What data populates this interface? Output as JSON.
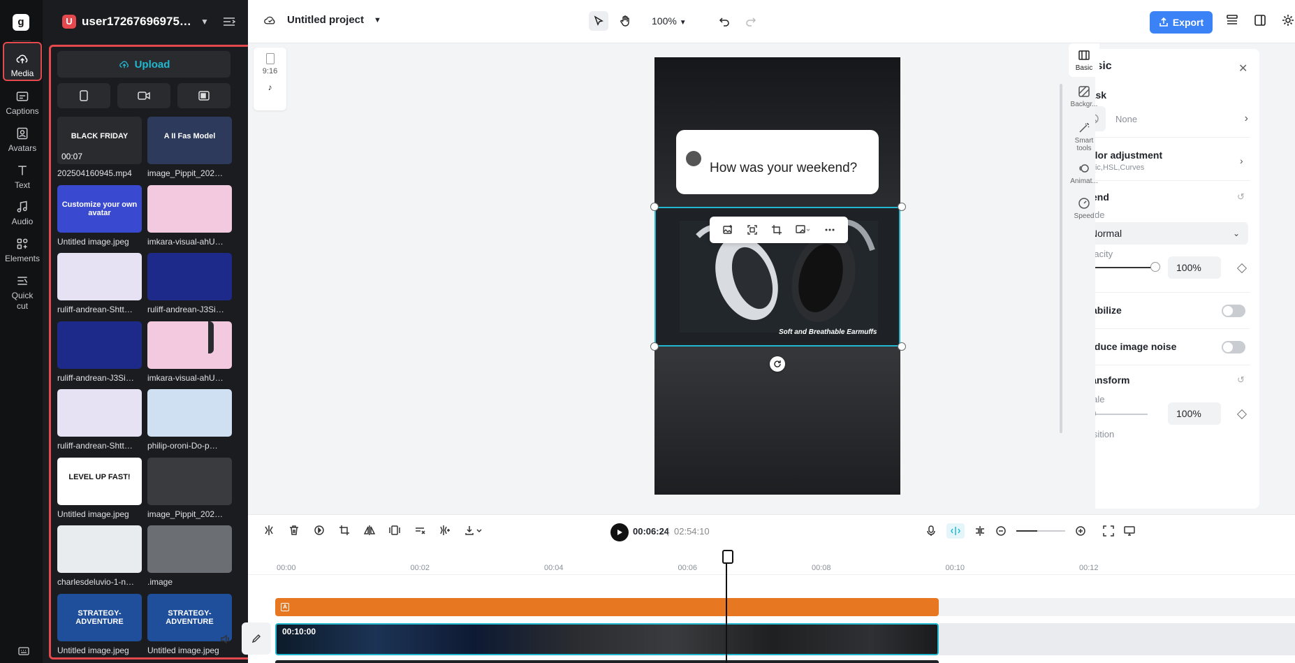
{
  "rail": {
    "items": [
      {
        "label": "Media",
        "icon": "cloud-upload-icon"
      },
      {
        "label": "Captions",
        "icon": "captions-icon"
      },
      {
        "label": "Avatars",
        "icon": "avatar-icon"
      },
      {
        "label": "Text",
        "icon": "text-icon"
      },
      {
        "label": "Audio",
        "icon": "music-note-icon"
      },
      {
        "label": "Elements",
        "icon": "elements-icon"
      },
      {
        "label": "Quick cut",
        "icon": "scissors-icon"
      }
    ]
  },
  "panel": {
    "user_initial": "U",
    "user_name": "user17267696975…",
    "upload_label": "Upload",
    "media": [
      {
        "name": "202504160945.mp4",
        "duration": "00:07",
        "thumb_text": "BLACK FRIDAY",
        "thumb_bg": "#2a2b2f"
      },
      {
        "name": "image_Pippit_202…",
        "thumb_text": "A II Fas Model",
        "thumb_bg": "#2e3a5c"
      },
      {
        "name": "Untitled image.jpeg",
        "thumb_text": "Customize your own avatar",
        "thumb_bg": "#3a4ad0"
      },
      {
        "name": "imkara-visual-ahU…",
        "thumb_text": "",
        "thumb_bg": "#f3c9e0"
      },
      {
        "name": "ruliff-andrean-Shtt…",
        "thumb_text": "",
        "thumb_bg": "#e6e2f3"
      },
      {
        "name": "ruliff-andrean-J3Si…",
        "thumb_text": "",
        "thumb_bg": "#1e2a8a"
      },
      {
        "name": "ruliff-andrean-J3Si…",
        "thumb_text": "",
        "thumb_bg": "#1e2a8a"
      },
      {
        "name": "imkara-visual-ahU…",
        "thumb_text": "",
        "thumb_bg": "#f3c9e0"
      },
      {
        "name": "ruliff-andrean-Shtt…",
        "thumb_text": "",
        "thumb_bg": "#e6e2f3"
      },
      {
        "name": "philip-oroni-Do-p…",
        "thumb_text": "",
        "thumb_bg": "#cfe0f3"
      },
      {
        "name": "Untitled image.jpeg",
        "thumb_text": "LEVEL UP FAST!",
        "thumb_bg": "#ffffff"
      },
      {
        "name": "image_Pippit_202…",
        "thumb_text": "",
        "thumb_bg": "#3a3b3e"
      },
      {
        "name": "charlesdeluvio-1-n…",
        "thumb_text": "",
        "thumb_bg": "#e9ecef"
      },
      {
        "name": ".image",
        "thumb_text": "",
        "thumb_bg": "#6b6e73"
      },
      {
        "name": "Untitled image.jpeg",
        "thumb_text": "STRATEGY-ADVENTURE",
        "thumb_bg": "#1f4f9a"
      },
      {
        "name": "Untitled image.jpeg",
        "thumb_text": "STRATEGY-ADVENTURE",
        "thumb_bg": "#1f4f9a"
      }
    ]
  },
  "topbar": {
    "project_name": "Untitled project",
    "zoom": "100%",
    "export_label": "Export"
  },
  "stage": {
    "ratio": "9:16",
    "bubble_text": "How was your weekend?",
    "image_caption": "Soft and Breathable Earmuffs"
  },
  "props": {
    "title": "Basic",
    "mask_title": "Mask",
    "mask_value": "None",
    "color_title": "Color adjustment",
    "color_sub": "Basic,HSL,Curves",
    "blend_title": "Blend",
    "mode_label": "Mode",
    "mode_value": "Normal",
    "opacity_label": "Opacity",
    "opacity_value": "100%",
    "stabilize_label": "Stabilize",
    "noise_label": "Reduce image noise",
    "transform_title": "Transform",
    "scale_label": "Scale",
    "scale_value": "100%",
    "position_label": "Position"
  },
  "tabrail": {
    "tabs": [
      {
        "label": "Basic"
      },
      {
        "label": "Backgr..."
      },
      {
        "label": "Smart tools"
      },
      {
        "label": "Animat..."
      },
      {
        "label": "Speed"
      }
    ]
  },
  "timeline": {
    "current_time": "00:06:24",
    "separator": "|",
    "total_time": "02:54:10",
    "ticks": [
      "00:00",
      "00:02",
      "00:04",
      "00:06",
      "00:08",
      "00:10",
      "00:12"
    ],
    "clip_duration": "00:10:00"
  },
  "colors": {
    "accent": "#22b8d0",
    "export": "#3b82f6",
    "highlight": "#e5484d",
    "text_track": "#e87722"
  }
}
